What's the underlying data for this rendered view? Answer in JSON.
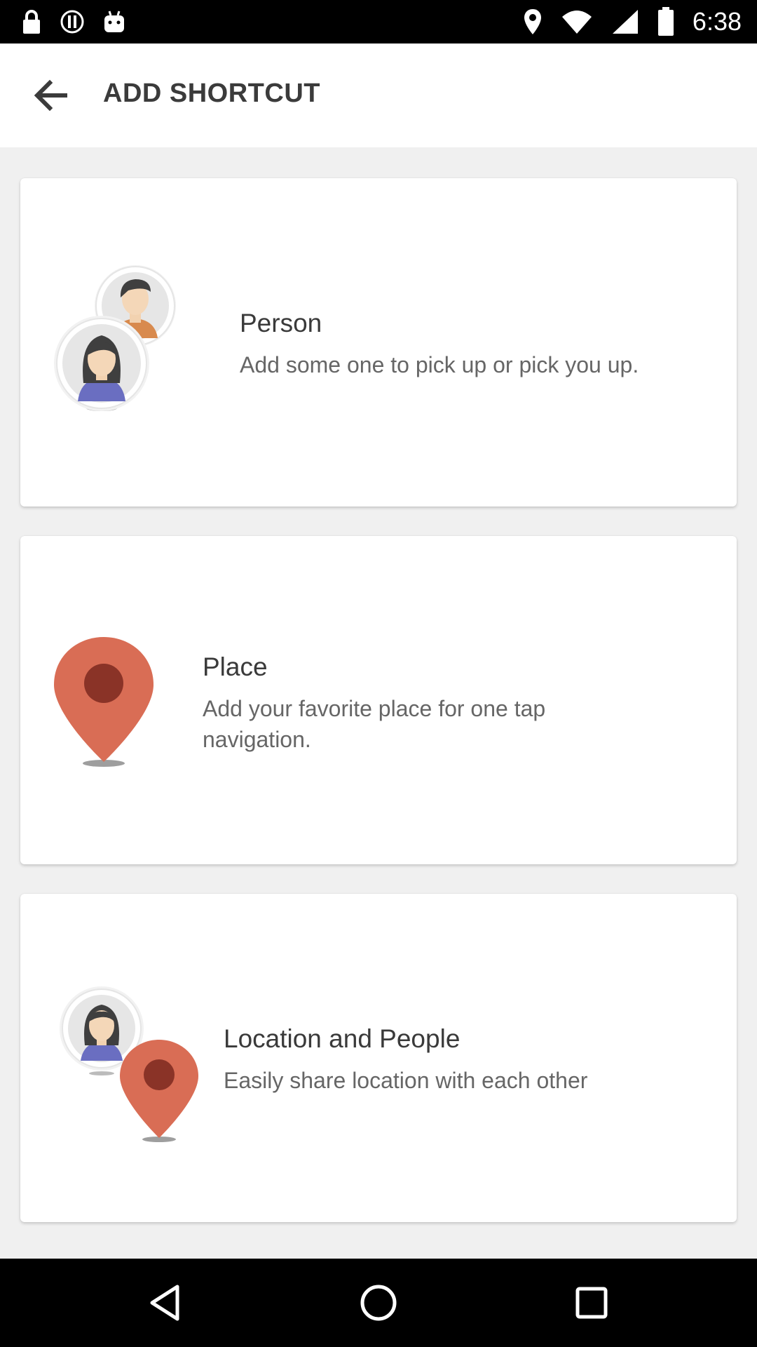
{
  "status_bar": {
    "time": "6:38",
    "left_icons": [
      "lock-icon",
      "alert-icon",
      "android-icon"
    ],
    "right_icons": [
      "location-icon",
      "wifi-icon",
      "signal-icon",
      "battery-icon"
    ]
  },
  "app_bar": {
    "back_icon": "arrow-back-icon",
    "title": "ADD SHORTCUT"
  },
  "cards": [
    {
      "title": "Person",
      "description": "Add some one to pick up or pick you up.",
      "icon": "person-avatars-icon"
    },
    {
      "title": "Place",
      "description": "Add your favorite place for one tap navigation.",
      "icon": "map-pin-icon"
    },
    {
      "title": "Location and People",
      "description": "Easily share location with each other",
      "icon": "person-with-pin-icon"
    }
  ],
  "nav_bar": {
    "buttons": [
      "back-triangle-icon",
      "home-circle-icon",
      "recents-square-icon"
    ]
  },
  "colors": {
    "pin": "#d96d55",
    "pin_dot": "#8a3327",
    "background": "#f0f0f0",
    "card": "#ffffff",
    "title_text": "#3a3a3a",
    "desc_text": "#666666"
  }
}
